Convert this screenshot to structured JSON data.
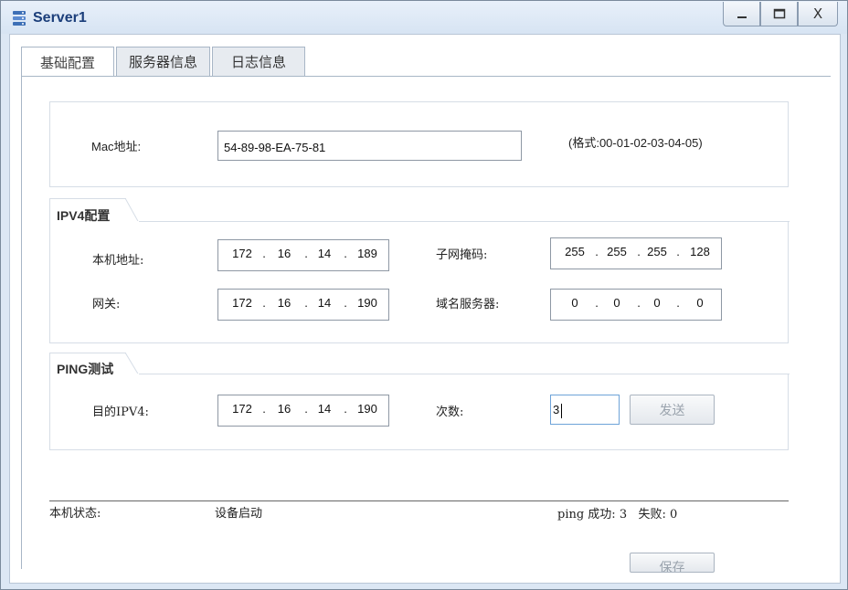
{
  "window": {
    "title": "Server1",
    "minimize_icon": "minimize-icon",
    "maximize_icon": "maximize-icon",
    "close_label": "X"
  },
  "tabs": [
    {
      "label": "基础配置",
      "active": true
    },
    {
      "label": "服务器信息",
      "active": false
    },
    {
      "label": "日志信息",
      "active": false
    }
  ],
  "mac_section": {
    "label": "Mac地址:",
    "value": "54-89-98-EA-75-81",
    "format_hint": "(格式:00-01-02-03-04-05)"
  },
  "ipv4_section": {
    "title": "IPV4配置",
    "local_address_label": "本机地址:",
    "local_address": [
      "172",
      "16",
      "14",
      "189"
    ],
    "subnet_mask_label": "子网掩码:",
    "subnet_mask": [
      "255",
      "255",
      "255",
      "128"
    ],
    "gateway_label": "网关:",
    "gateway": [
      "172",
      "16",
      "14",
      "190"
    ],
    "dns_label": "域名服务器:",
    "dns": [
      "0",
      "0",
      "0",
      "0"
    ]
  },
  "ping_section": {
    "title": "PING测试",
    "dest_label": "目的IPV4:",
    "dest": [
      "172",
      "16",
      "14",
      "190"
    ],
    "count_label": "次数:",
    "count_value": "3",
    "send_label": "发送"
  },
  "status": {
    "label": "本机状态:",
    "value": "设备启动",
    "ping_result": "ping 成功: 3   失败: 0"
  },
  "save_label": "保存",
  "colors": {
    "title": "#1b3e7a",
    "frame": "#dce7f4",
    "focus_border": "#6ea3d8"
  }
}
